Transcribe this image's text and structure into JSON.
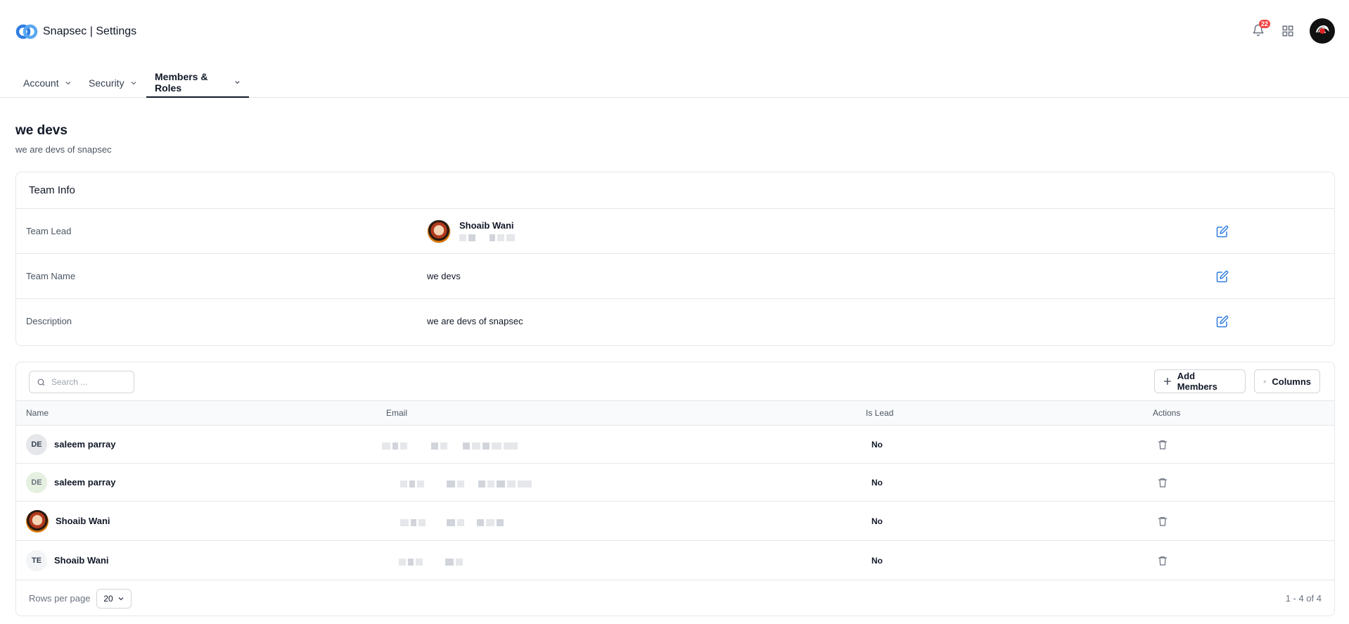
{
  "header": {
    "title": "Snapsec | Settings",
    "notification_count": "22",
    "brand_color": "#2f7de1"
  },
  "tabs": [
    {
      "label": "Account",
      "active": false
    },
    {
      "label": "Security",
      "active": false
    },
    {
      "label": "Members & Roles",
      "active": true
    }
  ],
  "page": {
    "title": "we devs",
    "subtitle": "we are devs of snapsec"
  },
  "team_info": {
    "title": "Team Info",
    "rows": [
      {
        "label": "Team Lead",
        "value": "Shoaib Wani"
      },
      {
        "label": "Team Name",
        "value": "we devs"
      },
      {
        "label": "Description",
        "value": "we are devs of snapsec"
      }
    ]
  },
  "members": {
    "search_placeholder": "Search ...",
    "add_label": "Add Members",
    "columns_label": "Columns",
    "headers": {
      "name": "Name",
      "email": "Email",
      "is_lead": "Is Lead",
      "actions": "Actions"
    },
    "rows": [
      {
        "initials": "DE",
        "name": "saleem parray",
        "is_lead": "No",
        "avatar_bg": "#e5e7eb"
      },
      {
        "initials": "DE",
        "name": "saleem parray",
        "is_lead": "No",
        "avatar_bg": "#e6f0e0"
      },
      {
        "initials": "",
        "name": "Shoaib Wani",
        "is_lead": "No",
        "avatar_bg": "photo"
      },
      {
        "initials": "TE",
        "name": "Shoaib Wani",
        "is_lead": "No",
        "avatar_bg": "#f3f4f6"
      }
    ],
    "rows_per_page_label": "Rows per page",
    "rows_per_page": "20",
    "range": "1 - 4 of 4"
  }
}
